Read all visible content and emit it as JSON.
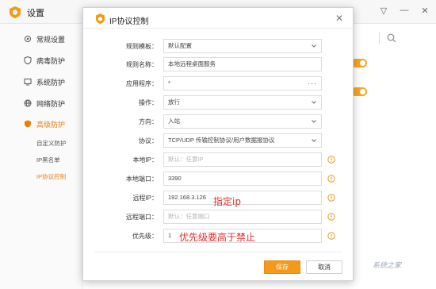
{
  "app": {
    "title": "设置",
    "window_controls": [
      "▽",
      "—",
      "✕"
    ]
  },
  "sidebar": {
    "items": [
      {
        "label": "常规设置",
        "icon": "gear-icon"
      },
      {
        "label": "病毒防护",
        "icon": "virus-shield-icon"
      },
      {
        "label": "系统防护",
        "icon": "system-icon"
      },
      {
        "label": "网络防护",
        "icon": "globe-icon"
      },
      {
        "label": "高级防护",
        "icon": "advanced-shield-icon"
      }
    ],
    "sub_items": [
      {
        "label": "自定义防护"
      },
      {
        "label": "IP黑名单"
      },
      {
        "label": "IP协议控制"
      }
    ]
  },
  "dialog": {
    "title": "IP协议控制",
    "close": "✕",
    "fields": {
      "template": {
        "label": "规则模板：",
        "value": "默认配置"
      },
      "name": {
        "label": "规则名称：",
        "value": "本地远程桌面服务"
      },
      "program": {
        "label": "应用程序：",
        "value": "*",
        "browse": "···"
      },
      "action": {
        "label": "操作：",
        "value": "放行"
      },
      "direction": {
        "label": "方向：",
        "value": "入站"
      },
      "protocol": {
        "label": "协议：",
        "value": "TCP/UDP 传输控制协议/用户数据报协议"
      },
      "local_ip": {
        "label": "本地IP：",
        "placeholder": "默认：任意IP"
      },
      "local_port": {
        "label": "本地端口：",
        "value": "3390"
      },
      "remote_ip": {
        "label": "远程IP：",
        "value": "192.168.3.126"
      },
      "remote_port": {
        "label": "远程端口：",
        "placeholder": "默认：任意端口"
      },
      "priority": {
        "label": "优先级：",
        "value": "1"
      }
    },
    "annotations": {
      "remote_ip_note": "指定ip",
      "priority_note": "优先级要高于禁止"
    },
    "buttons": {
      "save": "保存",
      "cancel": "取消"
    }
  },
  "watermark": "系统之家",
  "colors": {
    "accent": "#f39a1a",
    "annotation": "#e0302a",
    "active_nav": "#e8810c"
  }
}
